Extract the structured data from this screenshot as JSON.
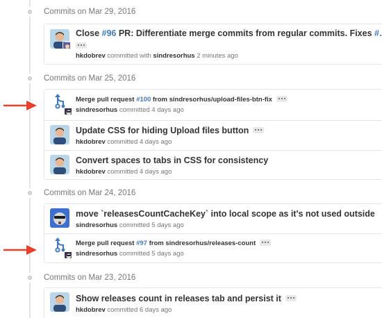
{
  "groups": [
    {
      "label": "Commits on Mar 29, 2016"
    },
    {
      "label": "Commits on Mar 25, 2016"
    },
    {
      "label": "Commits on Mar 24, 2016"
    },
    {
      "label": "Commits on Mar 23, 2016"
    }
  ],
  "commits": {
    "c1": {
      "prefix": "Close ",
      "pr": "#96",
      "suffix": " PR: Differentiate merge commits from regular commits. Fixes ",
      "trail": "#…",
      "author": "hkdobrev",
      "verb": " committed with ",
      "coauthor": "sindresorhus",
      "time": " 2 minutes ago"
    },
    "c2": {
      "prefix": "Merge pull request ",
      "pr": "#100",
      "suffix": " from sindresorhus/upload-files-btn-fix",
      "author": "sindresorhus",
      "time": " committed 4 days ago"
    },
    "c3": {
      "title": "Update CSS for hiding Upload files button",
      "author": "hkdobrev",
      "time": " committed 4 days ago"
    },
    "c4": {
      "title": "Convert spaces to tabs in CSS for consistency",
      "author": "hkdobrev",
      "time": " committed 4 days ago"
    },
    "c5": {
      "title": "move `releasesCountCacheKey` into local scope as it's not used outside",
      "author": "sindresorhus",
      "time": " committed 5 days ago"
    },
    "c6": {
      "prefix": "Merge pull request ",
      "pr": "#97",
      "suffix": " from sindresorhus/releases-count",
      "author": "sindresorhus",
      "time": " committed 5 days ago"
    },
    "c7": {
      "title": "Show releases count in releases tab and persist it",
      "author": "hkdobrev",
      "time": " committed 6 days ago"
    }
  },
  "colors": {
    "link": "#4078c0",
    "arrow": "#e8402a",
    "merge": "#4078c0"
  }
}
